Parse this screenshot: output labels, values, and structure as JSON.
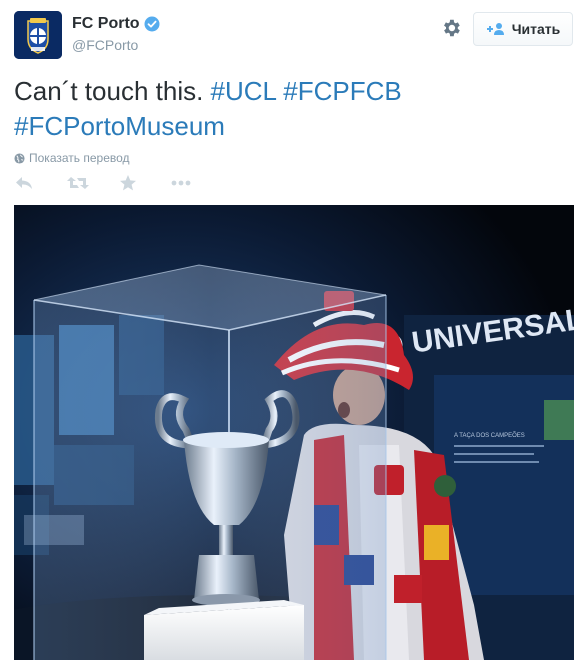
{
  "colors": {
    "text": "#292f33",
    "secondary": "#8899a6",
    "link": "#2b7bb9",
    "verified": "#55acee",
    "brand_blue": "#0a2a63"
  },
  "header": {
    "display_name": "FC Porto",
    "screen_name": "@FCPorto",
    "verified_icon": "verified-badge-icon",
    "settings_icon": "gear-icon",
    "follow_label": "Читать",
    "follow_icon": "add-user-icon"
  },
  "tweet": {
    "text_plain": "Can´t touch this.",
    "hashtags": [
      "#UCL",
      "#FCPFCB",
      "#FCPortoMuseum"
    ],
    "translate_label": "Показать перевод",
    "translate_icon": "globe-icon"
  },
  "actions": [
    {
      "name": "reply",
      "icon": "reply-icon"
    },
    {
      "name": "retweet",
      "icon": "retweet-icon"
    },
    {
      "name": "favorite",
      "icon": "star-icon"
    },
    {
      "name": "more",
      "icon": "more-dots-icon"
    }
  ],
  "media": {
    "banner_text": "O UNIVERSAL",
    "side_panel_text": "A TAÇA DOS CAMPEÕES"
  }
}
